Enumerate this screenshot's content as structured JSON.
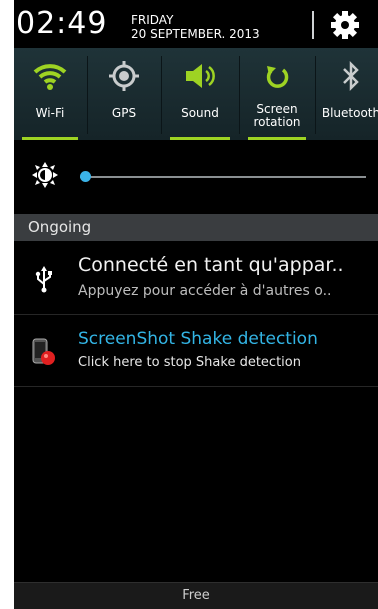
{
  "header": {
    "time": "02:49",
    "day": "FRIDAY",
    "date": "20 SEPTEMBER. 2013",
    "settings_icon": "gear-icon"
  },
  "toggles": [
    {
      "label": "Wi-Fi",
      "icon": "wifi-icon",
      "active": true
    },
    {
      "label": "GPS",
      "icon": "gps-icon",
      "active": false
    },
    {
      "label": "Sound",
      "icon": "sound-icon",
      "active": true
    },
    {
      "label_line1": "Screen",
      "label_line2": "rotation",
      "icon": "rotation-icon",
      "active": true
    },
    {
      "label": "Bluetooth",
      "icon": "bluetooth-icon",
      "active": false
    }
  ],
  "brightness": {
    "icon": "brightness-icon",
    "level_fraction": 0.02
  },
  "ongoing": {
    "label": "Ongoing"
  },
  "notifications": [
    {
      "icon": "usb-icon",
      "title": "Connecté en tant qu'appar..",
      "subtitle": "Appuyez pour accéder à d'autres o.."
    },
    {
      "icon": "screenshot-shake-icon",
      "title": "ScreenShot Shake detection",
      "subtitle": "Click here to stop Shake detection"
    }
  ],
  "footer": {
    "label": "Free"
  },
  "colors": {
    "accent_green": "#9ed323",
    "accent_blue": "#33b5e5"
  }
}
